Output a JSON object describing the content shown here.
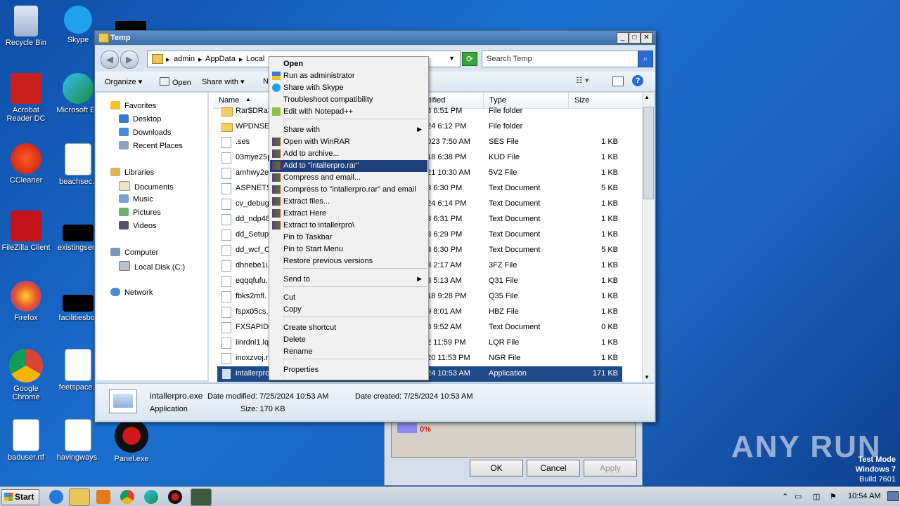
{
  "desktop": {
    "icons": [
      {
        "label": "Recycle Bin"
      },
      {
        "label": "Skype"
      },
      {
        "label": "Acrobat Reader DC"
      },
      {
        "label": "Microsoft Ed"
      },
      {
        "label": "CCleaner"
      },
      {
        "label": "beachsec.r"
      },
      {
        "label": "FileZilla Client"
      },
      {
        "label": "existingserv"
      },
      {
        "label": "Firefox"
      },
      {
        "label": "facilitiesbor"
      },
      {
        "label": "Google Chrome"
      },
      {
        "label": "feetspace.r"
      },
      {
        "label": "baduser.rtf"
      },
      {
        "label": "havingways."
      },
      {
        "label": "Panel.exe"
      }
    ]
  },
  "window": {
    "title": "Temp",
    "breadcrumb": [
      "admin",
      "AppData",
      "Local"
    ],
    "search_placeholder": "Search Temp",
    "toolbar": {
      "organize": "Organize",
      "open": "Open",
      "share_with": "Share with",
      "new_folder_partial": "N"
    },
    "nav": {
      "favorites": "Favorites",
      "desktop": "Desktop",
      "downloads": "Downloads",
      "recent_places": "Recent Places",
      "libraries": "Libraries",
      "documents": "Documents",
      "music": "Music",
      "pictures": "Pictures",
      "videos": "Videos",
      "computer": "Computer",
      "local_disk": "Local Disk (C:)",
      "network": "Network"
    },
    "columns": {
      "name": "Name",
      "date_modified": "odified",
      "type": "Type",
      "size": "Size"
    },
    "files": [
      {
        "name": "Rar$DRa3",
        "date": "23 6:51 PM",
        "type": "File folder",
        "size": "",
        "kind": "folder"
      },
      {
        "name": "WPDNSE",
        "date": "024 6:12 PM",
        "type": "File folder",
        "size": "",
        "kind": "folder"
      },
      {
        "name": ".ses",
        "date": "2023 7:50 AM",
        "type": "SES File",
        "size": "1 KB",
        "kind": "file"
      },
      {
        "name": "03mye25p",
        "date": "018 6:38 PM",
        "type": "KUD File",
        "size": "1 KB",
        "kind": "file"
      },
      {
        "name": "amhwy2e",
        "date": "021 10:30 AM",
        "type": "5V2 File",
        "size": "1 KB",
        "kind": "file"
      },
      {
        "name": "ASPNETSe",
        "date": "23 6:30 PM",
        "type": "Text Document",
        "size": "5 KB",
        "kind": "file"
      },
      {
        "name": "cv_debug",
        "date": "024 6:14 PM",
        "type": "Text Document",
        "size": "1 KB",
        "kind": "file"
      },
      {
        "name": "dd_ndp48",
        "date": "23 6:31 PM",
        "type": "Text Document",
        "size": "1 KB",
        "kind": "file"
      },
      {
        "name": "dd_Setup",
        "date": "23 6:29 PM",
        "type": "Text Document",
        "size": "1 KB",
        "kind": "file"
      },
      {
        "name": "dd_wcf_C",
        "date": "23 6:30 PM",
        "type": "Text Document",
        "size": "5 KB",
        "kind": "file"
      },
      {
        "name": "dhnebe1u",
        "date": "23 2:17 AM",
        "type": "3FZ File",
        "size": "1 KB",
        "kind": "file"
      },
      {
        "name": "eqqqfufu.",
        "date": "23 5:13 AM",
        "type": "Q31 File",
        "size": "1 KB",
        "kind": "file"
      },
      {
        "name": "fbks2mfl.",
        "date": "018 9:28 PM",
        "type": "Q35 File",
        "size": "1 KB",
        "kind": "file"
      },
      {
        "name": "fspx05cs.",
        "date": "19 8:01 AM",
        "type": "HBZ File",
        "size": "1 KB",
        "kind": "file"
      },
      {
        "name": "FXSAPIDe",
        "date": "18 9:52 AM",
        "type": "Text Document",
        "size": "0 KB",
        "kind": "file"
      },
      {
        "name": "iinrdnl1.lq",
        "date": "22 11:59 PM",
        "type": "LQR File",
        "size": "1 KB",
        "kind": "file"
      },
      {
        "name": "inoxzvoj.r",
        "date": "020 11:53 PM",
        "type": "NGR File",
        "size": "1 KB",
        "kind": "file"
      },
      {
        "name": "intallerpro",
        "date": "024 10:53 AM",
        "type": "Application",
        "size": "171 KB",
        "kind": "app"
      }
    ],
    "details": {
      "filename": "intallerpro.exe",
      "date_modified": "Date modified: 7/25/2024 10:53 AM",
      "date_created": "Date created: 7/25/2024 10:53 AM",
      "type": "Application",
      "size": "Size: 170 KB"
    }
  },
  "context_menu": {
    "items": [
      {
        "label": "Open",
        "bold": true
      },
      {
        "label": "Run as administrator"
      },
      {
        "label": "Share with Skype"
      },
      {
        "label": "Troubleshoot compatibility"
      },
      {
        "label": "Edit with Notepad++"
      },
      {
        "label": "Share with",
        "submenu": true
      },
      {
        "label": "Open with WinRAR"
      },
      {
        "label": "Add to archive..."
      },
      {
        "label": "Add to \"intallerpro.rar\"",
        "highlighted": true
      },
      {
        "label": "Compress and email..."
      },
      {
        "label": "Compress to \"intallerpro.rar\" and email"
      },
      {
        "label": "Extract files..."
      },
      {
        "label": "Extract Here"
      },
      {
        "label": "Extract to intallerpro\\"
      },
      {
        "label": "Pin to Taskbar"
      },
      {
        "label": "Pin to Start Menu"
      },
      {
        "label": "Restore previous versions"
      },
      {
        "label": "Send to",
        "submenu": true
      },
      {
        "label": "Cut"
      },
      {
        "label": "Copy"
      },
      {
        "label": "Create shortcut"
      },
      {
        "label": "Delete"
      },
      {
        "label": "Rename"
      },
      {
        "label": "Properties"
      }
    ]
  },
  "background_dialog": {
    "progress": "0%",
    "ok": "OK",
    "cancel": "Cancel",
    "apply": "Apply"
  },
  "taskbar": {
    "start": "Start",
    "clock": "10:54 AM"
  },
  "watermark": "ANY RUN",
  "windows_info": {
    "line1": "Test Mode",
    "line2": "Windows 7",
    "line3": "Build 7601"
  }
}
